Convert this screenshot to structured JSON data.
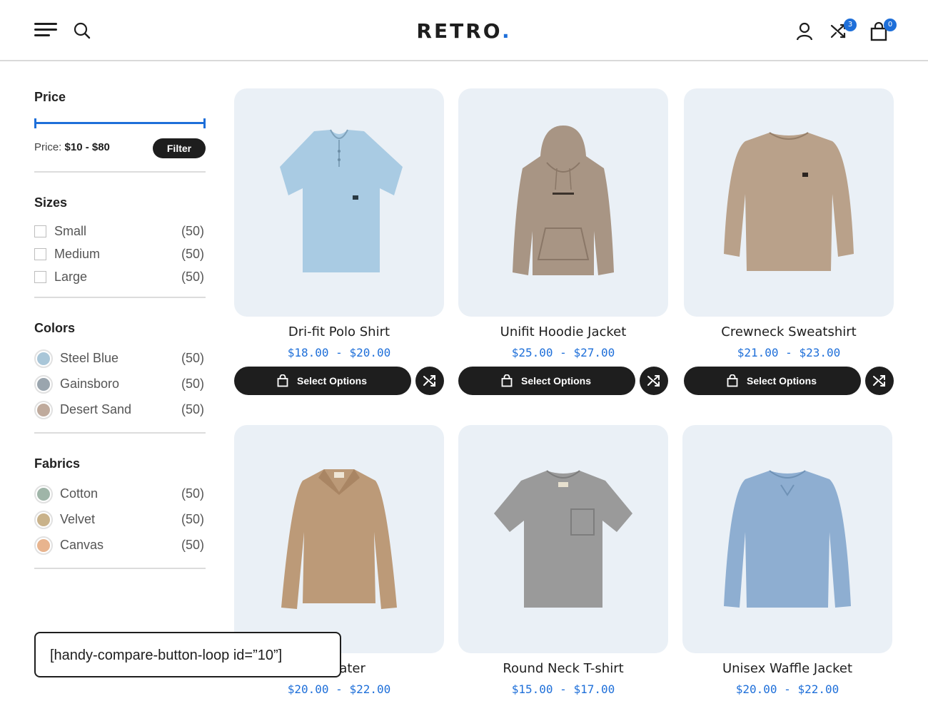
{
  "header": {
    "logo_text": "RETRO",
    "logo_dot": ".",
    "compare_count": "3",
    "cart_count": "0",
    "icons": [
      "menu-icon",
      "search-icon",
      "user-icon",
      "compare-icon",
      "bag-icon"
    ]
  },
  "colors": {
    "accent": "#1e6fd9",
    "dark": "#1e1e1e",
    "card_bg": "#eaf0f6"
  },
  "sidebar": {
    "price": {
      "title": "Price",
      "label": "Price:",
      "range": "$10 - $80",
      "filter_label": "Filter",
      "min_fraction": 0,
      "max_fraction": 1
    },
    "sizes": {
      "title": "Sizes",
      "items": [
        {
          "label": "Small",
          "count": "(50)"
        },
        {
          "label": "Medium",
          "count": "(50)"
        },
        {
          "label": "Large",
          "count": "(50)"
        }
      ]
    },
    "colors": {
      "title": "Colors",
      "items": [
        {
          "label": "Steel Blue",
          "count": "(50)",
          "color": "#a9c6d8"
        },
        {
          "label": "Gainsboro",
          "count": "(50)",
          "color": "#9aa5ae"
        },
        {
          "label": "Desert Sand",
          "count": "(50)",
          "color": "#bfaa9c"
        }
      ]
    },
    "fabrics": {
      "title": "Fabrics",
      "items": [
        {
          "label": "Cotton",
          "count": "(50)",
          "color": "#9fb5a8"
        },
        {
          "label": "Velvet",
          "count": "(50)",
          "color": "#c9b28a"
        },
        {
          "label": "Canvas",
          "count": "(50)",
          "color": "#e8b48e"
        }
      ]
    }
  },
  "products": [
    {
      "title": "Dri-fit Polo Shirt",
      "price": "$18.00 - $20.00",
      "button": "Select Options",
      "color": "#a9cbe3"
    },
    {
      "title": "Unifit Hoodie Jacket",
      "price": "$25.00 - $27.00",
      "button": "Select Options",
      "color": "#a89584"
    },
    {
      "title": "Crewneck Sweatshirt",
      "price": "$21.00 - $23.00",
      "button": "Select Options",
      "color": "#b9a18a"
    },
    {
      "title": "Sweater",
      "price": "$20.00 - $22.00",
      "color": "#bc9a78"
    },
    {
      "title": "Round Neck T-shirt",
      "price": "$15.00 - $17.00",
      "color": "#9a9a9a"
    },
    {
      "title": "Unisex Waffle Jacket",
      "price": "$20.00 - $22.00",
      "color": "#8eaed1"
    }
  ],
  "shortcode": "[handy-compare-button-loop id=”10”]"
}
